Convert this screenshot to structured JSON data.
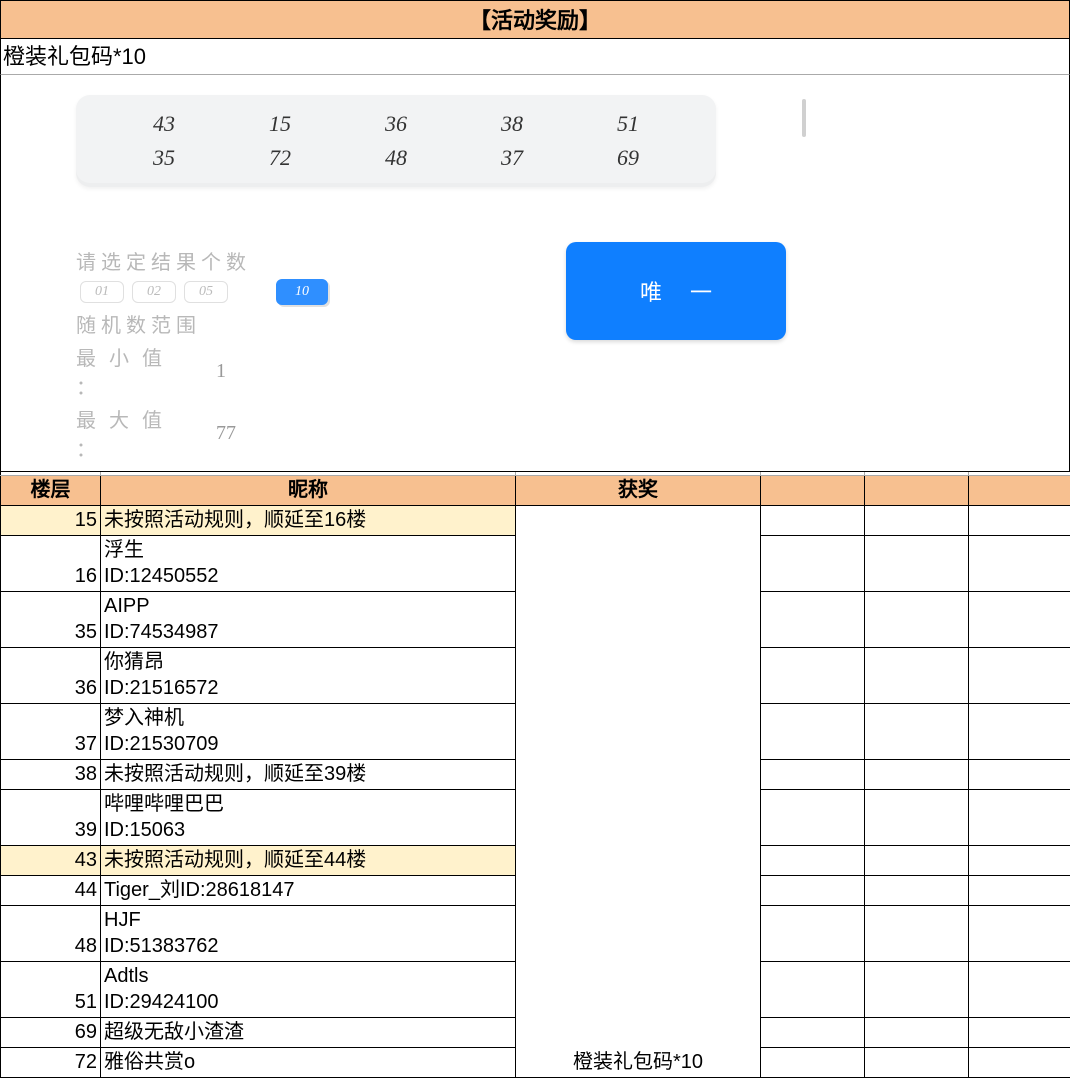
{
  "header": {
    "title": "【活动奖励】",
    "subtitle": "橙装礼包码*10"
  },
  "lottery": {
    "numbers_row1": [
      "43",
      "15",
      "36",
      "38",
      "51"
    ],
    "numbers_row2": [
      "35",
      "72",
      "48",
      "37",
      "69"
    ],
    "select_label": "请 选 定 结 果 个 数",
    "options": [
      "01",
      "02",
      "05"
    ],
    "selected_option": "10",
    "range_label": "随 机 数 范 围",
    "min_label": "最 小 值 ：",
    "min_value": "1",
    "max_label": "最 大 值 ：",
    "max_value": "77",
    "button": "唯一"
  },
  "table": {
    "col_floor": "楼层",
    "col_nick": "昵称",
    "col_prize": "获奖",
    "prize_text": "橙装礼包码*10",
    "rows": [
      {
        "floor": "15",
        "nick": "未按照活动规则，顺延至16楼",
        "hl": true
      },
      {
        "floor": "16",
        "nick": "浮生\nID:12450552"
      },
      {
        "floor": "35",
        "nick": "AIPP\nID:74534987"
      },
      {
        "floor": "36",
        "nick": "你猜昂\nID:21516572"
      },
      {
        "floor": "37",
        "nick": "梦入神机\nID:21530709"
      },
      {
        "floor": "38",
        "nick": "未按照活动规则，顺延至39楼"
      },
      {
        "floor": "39",
        "nick": "哔哩哔哩巴巴\nID:15063"
      },
      {
        "floor": "43",
        "nick": "未按照活动规则，顺延至44楼",
        "hl": true
      },
      {
        "floor": "44",
        "nick": "Tiger_刘ID:28618147"
      },
      {
        "floor": "48",
        "nick": "HJF\nID:51383762"
      },
      {
        "floor": "51",
        "nick": "Adtls\nID:29424100"
      },
      {
        "floor": "69",
        "nick": "超级无敌小渣渣"
      },
      {
        "floor": "72",
        "nick": "雅俗共赏o"
      }
    ]
  }
}
